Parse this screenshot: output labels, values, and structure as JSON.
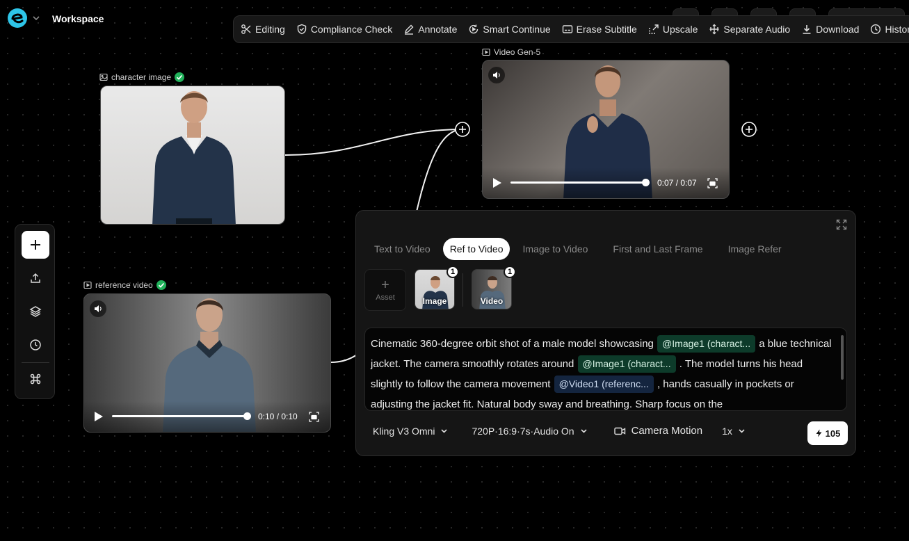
{
  "app": {
    "title": "Workspace"
  },
  "toolbar": [
    {
      "icon": "scissors-icon",
      "label": "Editing"
    },
    {
      "icon": "shield-check-icon",
      "label": "Compliance Check"
    },
    {
      "icon": "pen-icon",
      "label": "Annotate"
    },
    {
      "icon": "refresh-play-icon",
      "label": "Smart Continue"
    },
    {
      "icon": "subtitle-icon",
      "label": "Erase Subtitle"
    },
    {
      "icon": "upscale-icon",
      "label": "Upscale"
    },
    {
      "icon": "audio-split-icon",
      "label": "Separate Audio"
    },
    {
      "icon": "download-icon",
      "label": "Download"
    },
    {
      "icon": "history-icon",
      "label": "History"
    }
  ],
  "nodes": {
    "character_image": {
      "label": "character image",
      "status": "done"
    },
    "video_gen": {
      "label": "Video Gen-5",
      "time": "0:07 / 0:07",
      "progress": 1.0
    },
    "reference_video": {
      "label": "reference video",
      "status": "done",
      "time": "0:10 / 0:10",
      "progress": 1.0
    }
  },
  "left_tools": [
    "plus-icon",
    "upload-icon",
    "layers-icon",
    "clock-icon",
    "command-icon"
  ],
  "panel": {
    "tabs": [
      {
        "label": "Text to Video",
        "active": false
      },
      {
        "label": "Ref to Video",
        "active": true
      },
      {
        "label": "Image to Video",
        "active": false
      },
      {
        "label": "First and Last Frame",
        "active": false
      },
      {
        "label": "Image Refer",
        "active": false
      }
    ],
    "asset_button": {
      "plus": "+",
      "label": "Asset"
    },
    "refs": [
      {
        "label": "Image",
        "count": "1"
      },
      {
        "label": "Video",
        "count": "1"
      }
    ],
    "prompt": {
      "t1": "Cinematic 360-degree orbit shot of a male model showcasing",
      "c1": "@Image1 (charact...",
      "t2": "a blue technical jacket. The camera smoothly rotates around",
      "c2": "@Image1 (charact...",
      "t3": ". The model turns his head slightly to follow the camera movement",
      "c3": "@Video1 (referenc...",
      "t4": ", hands casually in pockets or adjusting the jacket fit. Natural body sway and breathing. Sharp focus on the"
    },
    "model": "Kling V3 Omni",
    "settings": "720P·16:9·7s·Audio On",
    "camera": "Camera Motion",
    "count": "1x",
    "credits": "105"
  },
  "colors": {
    "accent_check": "#21b25b",
    "image_chip": "#0d3b2a",
    "video_chip": "#14253f"
  }
}
